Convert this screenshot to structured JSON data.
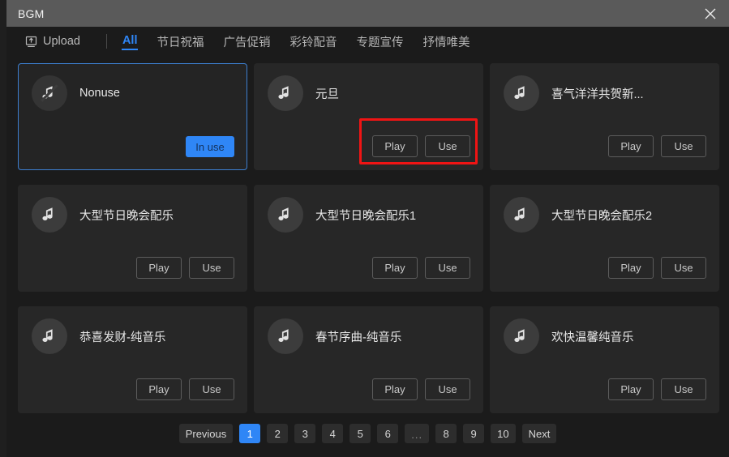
{
  "window": {
    "title": "BGM",
    "close_icon": "close-icon"
  },
  "toolbar": {
    "upload_label": "Upload",
    "upload_icon": "upload-icon",
    "tabs": [
      {
        "label": "All",
        "active": true
      },
      {
        "label": "节日祝福",
        "active": false
      },
      {
        "label": "广告促销",
        "active": false
      },
      {
        "label": "彩铃配音",
        "active": false
      },
      {
        "label": "专题宣传",
        "active": false
      },
      {
        "label": "抒情唯美",
        "active": false
      }
    ]
  },
  "labels": {
    "play": "Play",
    "use": "Use",
    "in_use": "In use"
  },
  "cards": [
    {
      "title": "Nonuse",
      "icon": "music-note-muted-icon",
      "selected": true,
      "state": "in-use"
    },
    {
      "title": "元旦",
      "icon": "music-note-icon",
      "selected": false,
      "state": "default",
      "annotated": true
    },
    {
      "title": "喜气洋洋共贺新...",
      "icon": "music-note-icon",
      "selected": false,
      "state": "default"
    },
    {
      "title": "大型节日晚会配乐",
      "icon": "music-note-icon",
      "selected": false,
      "state": "default"
    },
    {
      "title": "大型节日晚会配乐1",
      "icon": "music-note-icon",
      "selected": false,
      "state": "default"
    },
    {
      "title": "大型节日晚会配乐2",
      "icon": "music-note-icon",
      "selected": false,
      "state": "default"
    },
    {
      "title": "恭喜发财-纯音乐",
      "icon": "music-note-icon",
      "selected": false,
      "state": "default"
    },
    {
      "title": "春节序曲-纯音乐",
      "icon": "music-note-icon",
      "selected": false,
      "state": "default"
    },
    {
      "title": "欢快温馨纯音乐",
      "icon": "music-note-icon",
      "selected": false,
      "state": "default"
    }
  ],
  "pagination": {
    "previous_label": "Previous",
    "next_label": "Next",
    "pages": [
      "1",
      "2",
      "3",
      "4",
      "5",
      "6",
      "...",
      "8",
      "9",
      "10"
    ],
    "current_page": "1"
  },
  "colors": {
    "accent": "#2f86f6",
    "annotation": "#f01414",
    "titlebar": "#5a5a5a",
    "dialog_bg": "#1b1b1b",
    "card_bg": "#272727"
  }
}
